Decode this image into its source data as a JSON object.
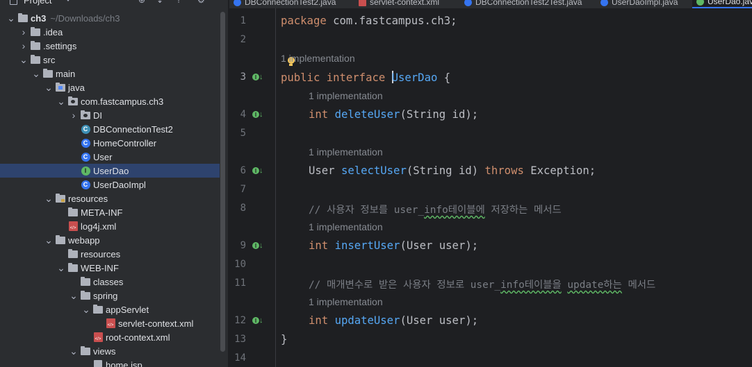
{
  "panel": {
    "title": "Project",
    "header_icons": [
      "crosshair-icon",
      "expand-all-icon",
      "collapse-all-icon",
      "settings-icon"
    ]
  },
  "tree": [
    {
      "depth": 0,
      "expanded": true,
      "icon": "folder",
      "label": "ch3",
      "path": "~/Downloads/ch3",
      "selected": false
    },
    {
      "depth": 1,
      "expanded": false,
      "icon": "folder",
      "label": ".idea",
      "path": "",
      "selected": false
    },
    {
      "depth": 1,
      "expanded": false,
      "icon": "folder",
      "label": ".settings",
      "path": "",
      "selected": false
    },
    {
      "depth": 1,
      "expanded": true,
      "icon": "folder",
      "label": "src",
      "path": "",
      "selected": false
    },
    {
      "depth": 2,
      "expanded": true,
      "icon": "folder",
      "label": "main",
      "path": "",
      "selected": false
    },
    {
      "depth": 3,
      "expanded": true,
      "icon": "folder-src",
      "label": "java",
      "path": "",
      "selected": false
    },
    {
      "depth": 4,
      "expanded": true,
      "icon": "package",
      "label": "com.fastcampus.ch3",
      "path": "",
      "selected": false
    },
    {
      "depth": 5,
      "expanded": false,
      "icon": "package",
      "label": "DI",
      "path": "",
      "selected": false
    },
    {
      "depth": 5,
      "expanded": null,
      "icon": "class-teal",
      "label": "DBConnectionTest2",
      "path": "",
      "selected": false
    },
    {
      "depth": 5,
      "expanded": null,
      "icon": "class",
      "label": "HomeController",
      "path": "",
      "selected": false
    },
    {
      "depth": 5,
      "expanded": null,
      "icon": "class",
      "label": "User",
      "path": "",
      "selected": false
    },
    {
      "depth": 5,
      "expanded": null,
      "icon": "interface",
      "label": "UserDao",
      "path": "",
      "selected": true
    },
    {
      "depth": 5,
      "expanded": null,
      "icon": "class",
      "label": "UserDaoImpl",
      "path": "",
      "selected": false
    },
    {
      "depth": 3,
      "expanded": true,
      "icon": "folder-res",
      "label": "resources",
      "path": "",
      "selected": false
    },
    {
      "depth": 4,
      "expanded": null,
      "icon": "folder",
      "label": "META-INF",
      "path": "",
      "selected": false
    },
    {
      "depth": 4,
      "expanded": null,
      "icon": "xml",
      "label": "log4j.xml",
      "path": "",
      "selected": false
    },
    {
      "depth": 3,
      "expanded": true,
      "icon": "folder",
      "label": "webapp",
      "path": "",
      "selected": false
    },
    {
      "depth": 4,
      "expanded": null,
      "icon": "folder",
      "label": "resources",
      "path": "",
      "selected": false
    },
    {
      "depth": 4,
      "expanded": true,
      "icon": "folder",
      "label": "WEB-INF",
      "path": "",
      "selected": false
    },
    {
      "depth": 5,
      "expanded": null,
      "icon": "folder",
      "label": "classes",
      "path": "",
      "selected": false
    },
    {
      "depth": 5,
      "expanded": true,
      "icon": "folder",
      "label": "spring",
      "path": "",
      "selected": false
    },
    {
      "depth": 6,
      "expanded": true,
      "icon": "folder",
      "label": "appServlet",
      "path": "",
      "selected": false
    },
    {
      "depth": 7,
      "expanded": null,
      "icon": "xml",
      "label": "servlet-context.xml",
      "path": "",
      "selected": false
    },
    {
      "depth": 6,
      "expanded": null,
      "icon": "xml",
      "label": "root-context.xml",
      "path": "",
      "selected": false
    },
    {
      "depth": 5,
      "expanded": true,
      "icon": "folder",
      "label": "views",
      "path": "",
      "selected": false
    },
    {
      "depth": 6,
      "expanded": null,
      "icon": "jsp",
      "label": "home.jsp",
      "path": "",
      "selected": false
    }
  ],
  "tabs": [
    {
      "label": "DBConnectionTest2.java",
      "icon": "class",
      "active": false
    },
    {
      "label": "servlet-context.xml",
      "icon": "xml",
      "active": false
    },
    {
      "label": "DBConnectionTest2Test.java",
      "icon": "class",
      "active": false
    },
    {
      "label": "UserDaoImpl.java",
      "icon": "class",
      "active": false
    },
    {
      "label": "UserDao.java",
      "icon": "interface",
      "active": true
    }
  ],
  "editor": {
    "current_line": 3,
    "line_numbers": [
      "1",
      "2",
      "3",
      "4",
      "5",
      "6",
      "7",
      "8",
      "9",
      "10",
      "11",
      "12",
      "13",
      "14"
    ],
    "implementation_markers": [
      "3",
      "4",
      "6",
      "9",
      "12"
    ],
    "hint_text": "1 implementation",
    "code": {
      "l1_kw": "package",
      "l1_rest": " com.fastcampus.ch3;",
      "l3_kw1": "public",
      "l3_kw2": "interface",
      "l3_name": "UserDao",
      "l3_brace": " {",
      "l4_type": "int",
      "l4_fn": "deleteUser",
      "l4_rest": "(String id);",
      "l6_type": "User",
      "l6_fn": "selectUser",
      "l6_args": "(String id) ",
      "l6_kw": "throws",
      "l6_rest": " Exception;",
      "l8_a": "// 사용자 정보를 user_",
      "l8_b": "info테이블에",
      "l8_c": " 저장하는 메서드",
      "l9_type": "int",
      "l9_fn": "insertUser",
      "l9_rest": "(User user);",
      "l11_a": "// 매개변수로 받은 사용자 정보로 user_",
      "l11_b": "info테이블을",
      "l11_c": " ",
      "l11_d": "update하는",
      "l11_e": " 메서드",
      "l12_type": "int",
      "l12_fn": "updateUser",
      "l12_rest": "(User user);",
      "l13": "}"
    }
  }
}
